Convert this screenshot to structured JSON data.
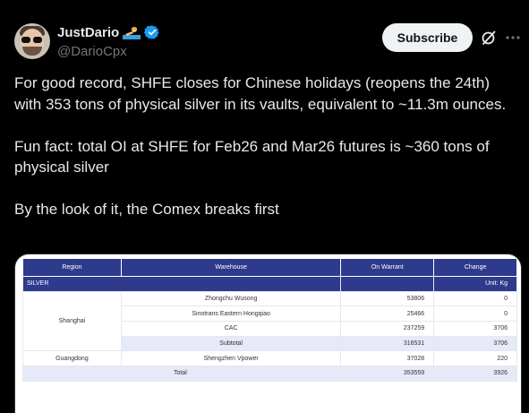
{
  "author": {
    "display_name": "JustDario",
    "handle": "@DarioCpx"
  },
  "header": {
    "subscribe_label": "Subscribe"
  },
  "post": {
    "paragraphs": [
      "For good record, SHFE closes for Chinese holidays (reopens the 24th) with 353 tons of physical silver in its vaults, equivalent to ~11.3m ounces.",
      "Fun fact: total OI at SHFE for Feb26 and Mar26 futures is ~360 tons of physical silver",
      "By the look of it, the Comex breaks first"
    ]
  },
  "image_table": {
    "headers": [
      "Region",
      "Warehouse",
      "On Warrant",
      "Change"
    ],
    "section_label": "SILVER",
    "unit_label": "Unit:  Kg",
    "rows": [
      {
        "region": "",
        "warehouse": "Zhongchu Wusong",
        "on_warrant": "53806",
        "change": "0"
      },
      {
        "region": "Shanghai",
        "warehouse": "Sinotrans Eastern Hongqiao",
        "on_warrant": "25466",
        "change": "0"
      },
      {
        "region": "",
        "warehouse": "CAC",
        "on_warrant": "237259",
        "change": "3706"
      },
      {
        "region": "",
        "warehouse": "Subtotal",
        "on_warrant": "316531",
        "change": "3706"
      },
      {
        "region": "Guangdong",
        "warehouse": "Shengzhen Vpower",
        "on_warrant": "37028",
        "change": "220"
      }
    ],
    "total": {
      "label": "Total",
      "on_warrant": "353559",
      "change": "3926"
    }
  },
  "icons": {
    "verified": "verified-badge-icon",
    "emoji": "swimmer-emoji-icon",
    "grok": "grok-icon",
    "more": "more-icon"
  },
  "colors": {
    "verified": "#1d9bf0",
    "table_header": "#2e3a8c",
    "subscribe_bg": "#eff3f4"
  }
}
